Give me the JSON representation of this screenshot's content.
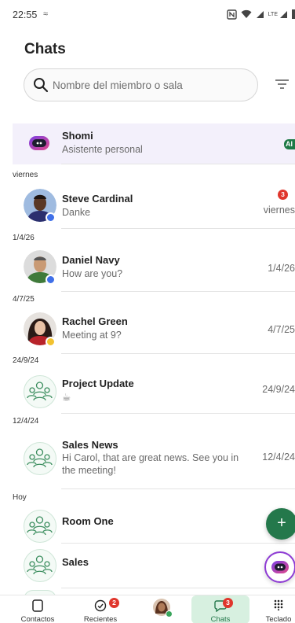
{
  "status_bar": {
    "time": "22:55",
    "network": "LTE"
  },
  "header": {
    "title": "Chats"
  },
  "search": {
    "placeholder": "Nombre del miembro o sala"
  },
  "sections": [
    "viernes",
    "1/4/26",
    "4/7/25",
    "24/9/24",
    "12/4/24",
    "Hoy"
  ],
  "chats": [
    {
      "name": "Shomi",
      "preview": "Asistente personal",
      "time": "",
      "badge": "AI"
    },
    {
      "name": "Steve Cardinal",
      "preview": "Danke",
      "time": "viernes",
      "unread": "3",
      "presence_color": "#3f6fe8"
    },
    {
      "name": "Daniel Navy",
      "preview": "How are you?",
      "time": "1/4/26",
      "presence_color": "#3f6fe8"
    },
    {
      "name": "Rachel Green",
      "preview": "Meeting at 9?",
      "time": "4/7/25",
      "presence_color": "#f2c230"
    },
    {
      "name": "Project Update",
      "preview": "☕",
      "time": "24/9/24"
    },
    {
      "name": "Sales News",
      "preview": "Hi Carol, that are great news. See you in the meeting!",
      "time": "12/4/24"
    },
    {
      "name": "Room One",
      "preview": "",
      "time": ""
    },
    {
      "name": "Sales",
      "preview": "",
      "time": ""
    }
  ],
  "fab": {
    "plus": "+"
  },
  "bottom_nav": {
    "items": [
      {
        "label": "Contactos"
      },
      {
        "label": "Recientes",
        "badge": "2"
      },
      {
        "label": ""
      },
      {
        "label": "Chats",
        "badge": "3"
      },
      {
        "label": "Teclado"
      }
    ]
  },
  "colors": {
    "accent": "#24784b",
    "badge": "#e0362c",
    "highlight": "#f3f0fb",
    "shomi_purple": "#8e3bd4"
  }
}
